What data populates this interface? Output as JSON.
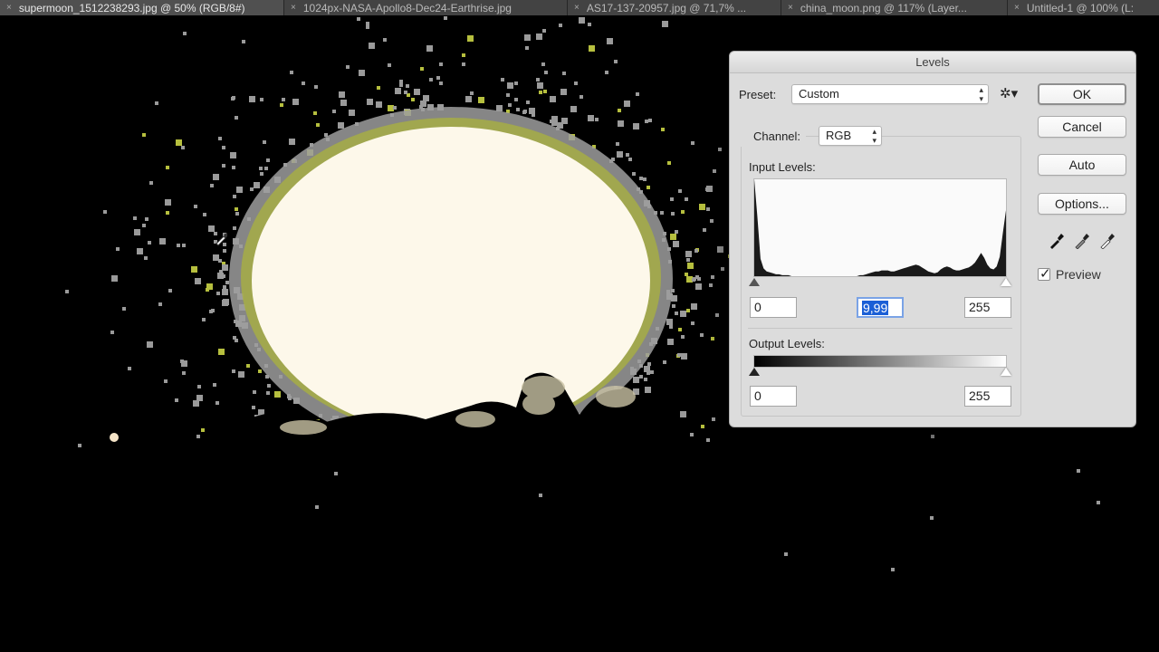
{
  "tabs": [
    {
      "label": "supermoon_1512238293.jpg @ 50% (RGB/8#)",
      "active": true
    },
    {
      "label": "1024px-NASA-Apollo8-Dec24-Earthrise.jpg",
      "active": false
    },
    {
      "label": "AS17-137-20957.jpg @ 71,7% ...",
      "active": false
    },
    {
      "label": "china_moon.png @ 117% (Layer...",
      "active": false
    },
    {
      "label": "Untitled-1 @ 100% (L:",
      "active": false
    }
  ],
  "tab_close_glyph": "×",
  "canvas": {
    "subject": "full moon rising over trees, posterized background noise",
    "background_color": "#000000",
    "moon_color": "#fdf8ea",
    "fringe_color": "#a8a8a8",
    "fringe_accent": "#b5c23a"
  },
  "levels": {
    "title": "Levels",
    "preset_label": "Preset:",
    "preset_value": "Custom",
    "gear_icon": "gear-icon",
    "channel_label": "Channel:",
    "channel_value": "RGB",
    "input_levels_label": "Input Levels:",
    "input_black": "0",
    "input_gamma": "9,99",
    "input_white": "255",
    "output_levels_label": "Output Levels:",
    "output_black": "0",
    "output_white": "255",
    "buttons": {
      "ok": "OK",
      "cancel": "Cancel",
      "auto": "Auto",
      "options": "Options..."
    },
    "eyedroppers": [
      "black-point-eyedropper-icon",
      "gray-point-eyedropper-icon",
      "white-point-eyedropper-icon"
    ],
    "preview_label": "Preview",
    "preview_checked": true,
    "histogram": [
      100,
      62,
      18,
      8,
      5,
      4,
      3,
      2,
      2,
      1,
      1,
      1,
      0,
      0,
      0,
      0,
      0,
      0,
      0,
      0,
      0,
      0,
      0,
      0,
      0,
      0,
      0,
      0,
      0,
      0,
      0,
      0,
      0,
      0,
      1,
      1,
      2,
      3,
      4,
      5,
      5,
      6,
      6,
      6,
      5,
      5,
      6,
      7,
      8,
      9,
      10,
      11,
      12,
      11,
      9,
      7,
      5,
      4,
      3,
      4,
      7,
      9,
      10,
      9,
      7,
      6,
      6,
      7,
      8,
      9,
      11,
      14,
      19,
      24,
      19,
      12,
      8,
      7,
      10,
      20,
      45,
      68
    ]
  }
}
